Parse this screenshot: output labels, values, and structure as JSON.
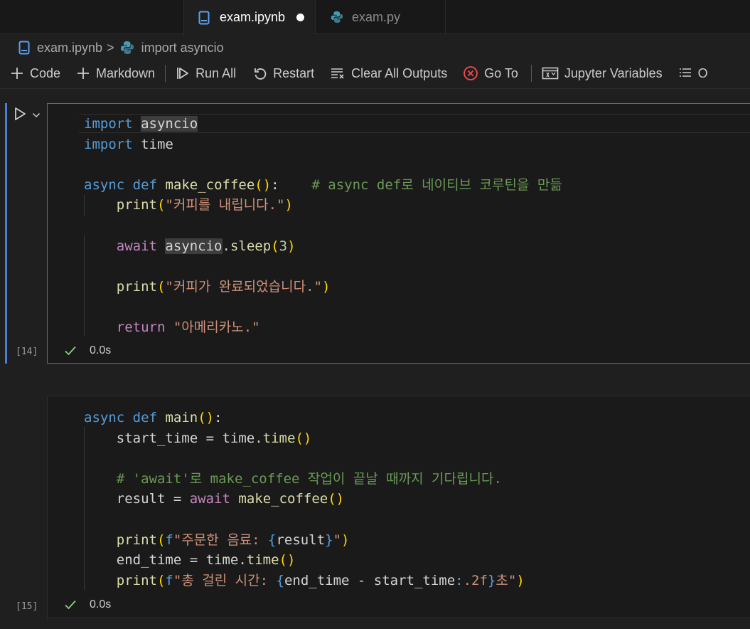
{
  "tabs": [
    {
      "label": "exam.ipynb",
      "active": true,
      "modified": true,
      "icon": "notebook-icon"
    },
    {
      "label": "exam.py",
      "active": false,
      "icon": "python-icon"
    }
  ],
  "breadcrumb": {
    "file": "exam.ipynb",
    "separator": ">",
    "symbol": "import asyncio"
  },
  "toolbar": {
    "code": "Code",
    "markdown": "Markdown",
    "run_all": "Run All",
    "restart": "Restart",
    "clear_all_outputs": "Clear All Outputs",
    "go_to": "Go To",
    "jupyter_variables": "Jupyter Variables",
    "outline": "O"
  },
  "cells": [
    {
      "execution_count": "[14]",
      "status_text": "0.0s",
      "lines": [
        [
          [
            "kw",
            "import"
          ],
          [
            "plain",
            " "
          ],
          [
            "hl",
            "asyncio"
          ]
        ],
        [
          [
            "kw",
            "import"
          ],
          [
            "plain",
            " time"
          ]
        ],
        [],
        [
          [
            "kw",
            "async"
          ],
          [
            "plain",
            " "
          ],
          [
            "kw",
            "def"
          ],
          [
            "plain",
            " "
          ],
          [
            "fn",
            "make_coffee"
          ],
          [
            "br",
            "()"
          ],
          [
            "plain",
            ":    "
          ],
          [
            "cmt",
            "# async def로 네이티브 코루틴을 만듦"
          ]
        ],
        [
          [
            "plain",
            "    "
          ],
          [
            "fn",
            "print"
          ],
          [
            "br",
            "("
          ],
          [
            "str",
            "\"커피를 내립니다.\""
          ],
          [
            "br",
            ")"
          ]
        ],
        [],
        [
          [
            "plain",
            "    "
          ],
          [
            "ctl",
            "await"
          ],
          [
            "plain",
            " "
          ],
          [
            "hl",
            "asyncio"
          ],
          [
            "plain",
            "."
          ],
          [
            "fn",
            "sleep"
          ],
          [
            "br",
            "("
          ],
          [
            "num",
            "3"
          ],
          [
            "br",
            ")"
          ]
        ],
        [],
        [
          [
            "plain",
            "    "
          ],
          [
            "fn",
            "print"
          ],
          [
            "br",
            "("
          ],
          [
            "str",
            "\"커피가 완료되었습니다.\""
          ],
          [
            "br",
            ")"
          ]
        ],
        [],
        [
          [
            "plain",
            "    "
          ],
          [
            "ctl",
            "return"
          ],
          [
            "plain",
            " "
          ],
          [
            "str",
            "\"아메리카노.\""
          ]
        ]
      ]
    },
    {
      "execution_count": "[15]",
      "status_text": "0.0s",
      "lines": [
        [
          [
            "kw",
            "async"
          ],
          [
            "plain",
            " "
          ],
          [
            "kw",
            "def"
          ],
          [
            "plain",
            " "
          ],
          [
            "fn",
            "main"
          ],
          [
            "br",
            "()"
          ],
          [
            "plain",
            ":"
          ]
        ],
        [
          [
            "plain",
            "    start_time = time."
          ],
          [
            "fn",
            "time"
          ],
          [
            "br",
            "()"
          ]
        ],
        [],
        [
          [
            "plain",
            "    "
          ],
          [
            "cmt",
            "# 'await'로 make_coffee 작업이 끝날 때까지 기다립니다."
          ]
        ],
        [
          [
            "plain",
            "    result = "
          ],
          [
            "ctl",
            "await"
          ],
          [
            "plain",
            " "
          ],
          [
            "fn",
            "make_coffee"
          ],
          [
            "br",
            "()"
          ]
        ],
        [],
        [
          [
            "plain",
            "    "
          ],
          [
            "fn",
            "print"
          ],
          [
            "br",
            "("
          ],
          [
            "kw",
            "f"
          ],
          [
            "str",
            "\"주문한 음료: "
          ],
          [
            "kw",
            "{"
          ],
          [
            "plain",
            "result"
          ],
          [
            "kw",
            "}"
          ],
          [
            "str",
            "\""
          ],
          [
            "br",
            ")"
          ]
        ],
        [
          [
            "plain",
            "    end_time = time."
          ],
          [
            "fn",
            "time"
          ],
          [
            "br",
            "()"
          ]
        ],
        [
          [
            "plain",
            "    "
          ],
          [
            "fn",
            "print"
          ],
          [
            "br",
            "("
          ],
          [
            "kw",
            "f"
          ],
          [
            "str",
            "\"총 걸린 시간: "
          ],
          [
            "kw",
            "{"
          ],
          [
            "plain",
            "end_time - start_time"
          ],
          [
            "kw",
            ":"
          ],
          [
            "str",
            ".2f"
          ],
          [
            "kw",
            "}"
          ],
          [
            "str",
            "초\""
          ],
          [
            "br",
            ")"
          ]
        ]
      ]
    }
  ]
}
